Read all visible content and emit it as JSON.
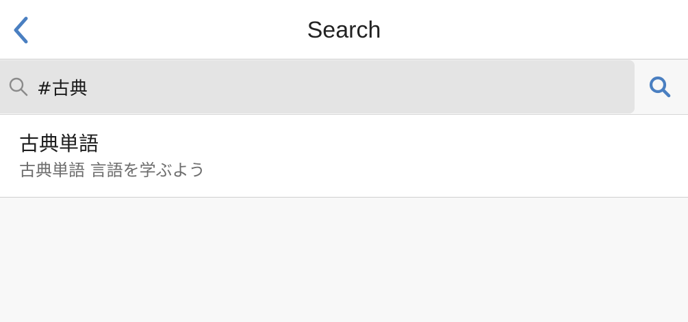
{
  "colors": {
    "accent": "#4a7fc1",
    "navbar_bg": "#ffffff",
    "search_field_bg": "#e4e4e4",
    "page_bg": "#f8f8f8"
  },
  "navbar": {
    "title": "Search",
    "back_icon": "chevron-left-icon"
  },
  "search": {
    "value": "#古典",
    "placeholder": "",
    "left_icon": "magnifier-icon",
    "submit_icon": "search-icon"
  },
  "results": [
    {
      "title": "古典単語",
      "subtitle": "古典単語 言語を学ぶよう"
    }
  ]
}
